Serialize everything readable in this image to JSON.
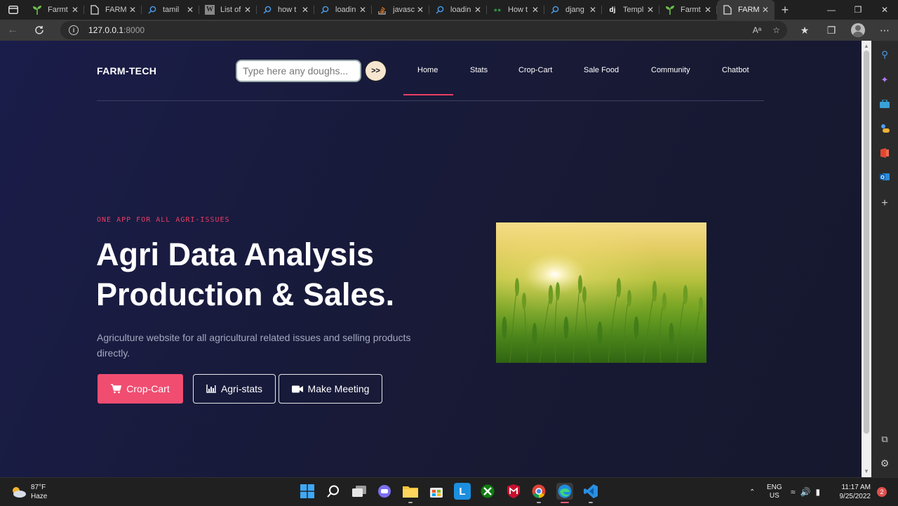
{
  "browser": {
    "tabs": [
      {
        "title": "Farmt",
        "icon": "sprout-icon",
        "active": false
      },
      {
        "title": "FARM",
        "icon": "page-icon",
        "active": false
      },
      {
        "title": "tamil",
        "icon": "search-icon",
        "active": false
      },
      {
        "title": "List of",
        "icon": "wikipedia-icon",
        "active": false
      },
      {
        "title": "how t",
        "icon": "search-icon",
        "active": false
      },
      {
        "title": "loadin",
        "icon": "search-icon",
        "active": false
      },
      {
        "title": "javasc",
        "icon": "stackoverflow-icon",
        "active": false
      },
      {
        "title": "loadin",
        "icon": "search-icon",
        "active": false
      },
      {
        "title": "How t",
        "icon": "geeks-icon",
        "active": false
      },
      {
        "title": "djang",
        "icon": "search-icon",
        "active": false
      },
      {
        "title": "Templ",
        "icon": "django-icon",
        "active": false
      },
      {
        "title": "Farmt",
        "icon": "sprout-icon",
        "active": false
      },
      {
        "title": "FARM",
        "icon": "page-icon",
        "active": true
      }
    ],
    "url_host": "127.0.0.1",
    "url_port": ":8000",
    "wiki_glyph": "W",
    "django_glyph": "dj",
    "read_aloud_glyph": "Aᵃ"
  },
  "site": {
    "brand": "FARM-TECH",
    "search": {
      "placeholder": "Type here any doughs...",
      "button_label": ">>"
    },
    "nav": [
      {
        "label": "Home",
        "active": true
      },
      {
        "label": "Stats",
        "active": false
      },
      {
        "label": "Crop-Cart",
        "active": false
      },
      {
        "label": "Sale Food",
        "active": false
      },
      {
        "label": "Community",
        "active": false
      },
      {
        "label": "Chatbot",
        "active": false
      }
    ],
    "hero": {
      "eyebrow": "ONE APP FOR ALL AGRI-ISSUES",
      "title_line1": "Agri Data Analysis",
      "title_line2": "Production & Sales.",
      "description": "Agriculture website for all agricultural related issues and selling products directly.",
      "buttons": {
        "crop_cart": "Crop-Cart",
        "agri_stats": "Agri-stats",
        "make_meeting": "Make Meeting"
      }
    },
    "colors": {
      "accent": "#ea3d64",
      "primary_button": "#f04d71"
    }
  },
  "taskbar": {
    "weather_temp": "87°F",
    "weather_desc": "Haze",
    "lang_top": "ENG",
    "lang_bottom": "US",
    "time": "11:17 AM",
    "date": "9/25/2022",
    "notification_count": "2"
  }
}
